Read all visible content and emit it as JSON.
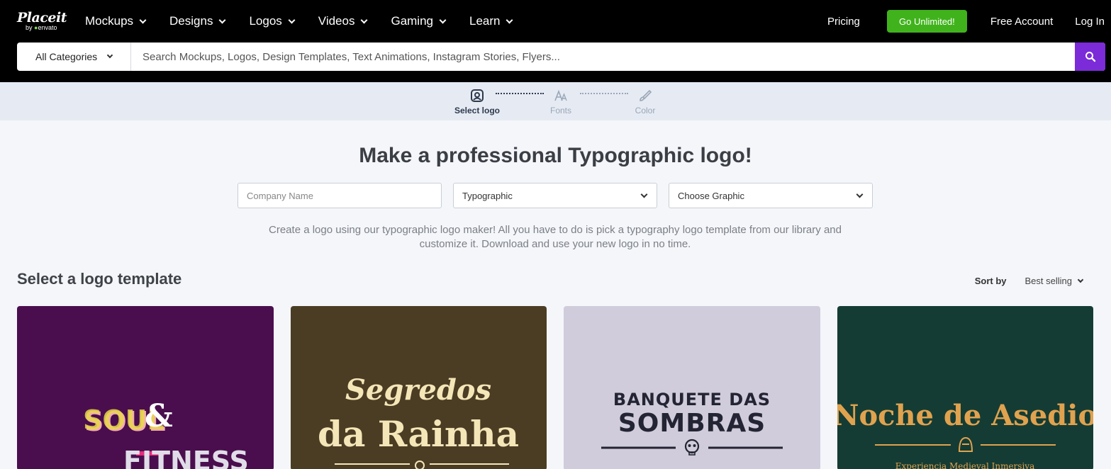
{
  "brand": {
    "name": "Placeit",
    "by": "by",
    "parent": "envato"
  },
  "nav": {
    "items": [
      {
        "label": "Mockups"
      },
      {
        "label": "Designs"
      },
      {
        "label": "Logos"
      },
      {
        "label": "Videos"
      },
      {
        "label": "Gaming"
      },
      {
        "label": "Learn"
      }
    ]
  },
  "header_right": {
    "pricing": "Pricing",
    "go_unlimited": "Go Unlimited!",
    "free_account": "Free Account",
    "login": "Log In"
  },
  "search": {
    "category": "All Categories",
    "placeholder": "Search Mockups, Logos, Design Templates, Text Animations, Instagram Stories, Flyers..."
  },
  "steps": [
    {
      "label": "Select logo"
    },
    {
      "label": "Fonts"
    },
    {
      "label": "Color"
    }
  ],
  "main": {
    "title": "Make a professional Typographic logo!",
    "company_placeholder": "Company Name",
    "type_select": "Typographic",
    "graphic_select": "Choose Graphic",
    "description": "Create a logo using our typographic logo maker! All you have to do is pick a typography logo template from our library and customize it. Download and use your new logo in no time."
  },
  "templates": {
    "section_title": "Select a logo template",
    "sort_label": "Sort by",
    "sort_value": "Best selling",
    "cards": [
      {
        "line1": "SOUL",
        "amp": "&",
        "line2": "FITNESS",
        "bg": "#4a0e4e"
      },
      {
        "line1": "Segredos",
        "line2": "da Rainha",
        "bg": "#4b3d24"
      },
      {
        "line1": "BANQUETE DAS",
        "line2": "SOMBRAS",
        "bg": "#d0ccdb"
      },
      {
        "line1": "Noche de Asedio",
        "line2": "Experiencia Medieval Inmersiva",
        "bg": "#153c34"
      }
    ]
  },
  "colors": {
    "accent_green": "#40b31c",
    "accent_purple": "#7b2bd8"
  }
}
